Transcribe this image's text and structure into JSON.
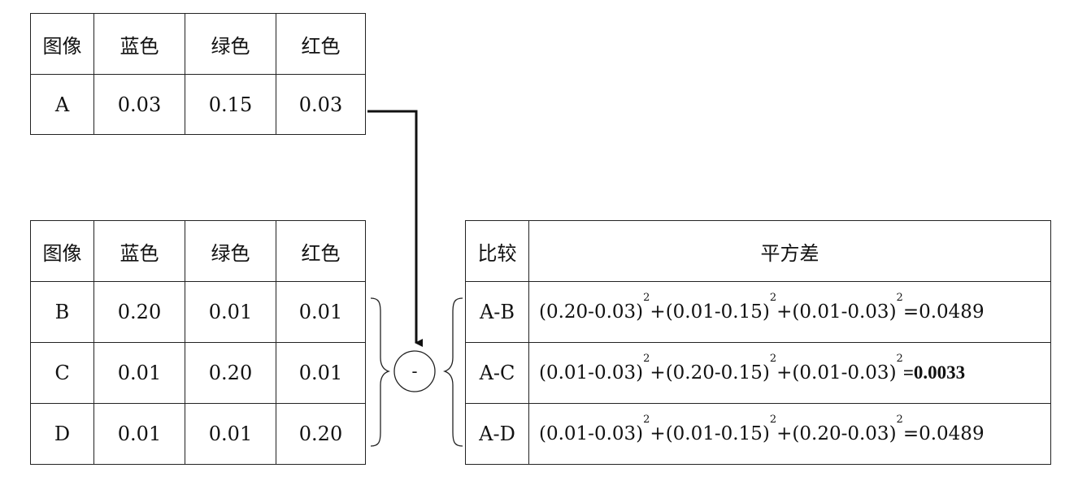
{
  "query_table": {
    "headers": [
      "图像",
      "蓝色",
      "绿色",
      "红色"
    ],
    "row": [
      "A",
      "0.03",
      "0.15",
      "0.03"
    ]
  },
  "db_table": {
    "headers": [
      "图像",
      "蓝色",
      "绿色",
      "红色"
    ],
    "rows": [
      [
        "B",
        "0.20",
        "0.01",
        "0.01"
      ],
      [
        "C",
        "0.01",
        "0.20",
        "0.01"
      ],
      [
        "D",
        "0.01",
        "0.01",
        "0.20"
      ]
    ]
  },
  "operator": "-",
  "compare_table": {
    "headers": [
      "比较",
      "平方差"
    ],
    "rows": [
      {
        "pair": "A-B",
        "t1": "(0.20-0.03)",
        "t2": "+(0.01-0.15)",
        "t3": "+(0.01-0.03)",
        "result": "=0.0489",
        "bold": false
      },
      {
        "pair": "A-C",
        "t1": "(0.01-0.03)",
        "t2": "+(0.20-0.15)",
        "t3": "+(0.01-0.03)",
        "result": "=0.0033",
        "bold": true
      },
      {
        "pair": "A-D",
        "t1": "(0.01-0.03)",
        "t2": "+(0.01-0.15)",
        "t3": "+(0.20-0.03)",
        "result": "=0.0489",
        "bold": false
      }
    ],
    "exponent": "2"
  }
}
